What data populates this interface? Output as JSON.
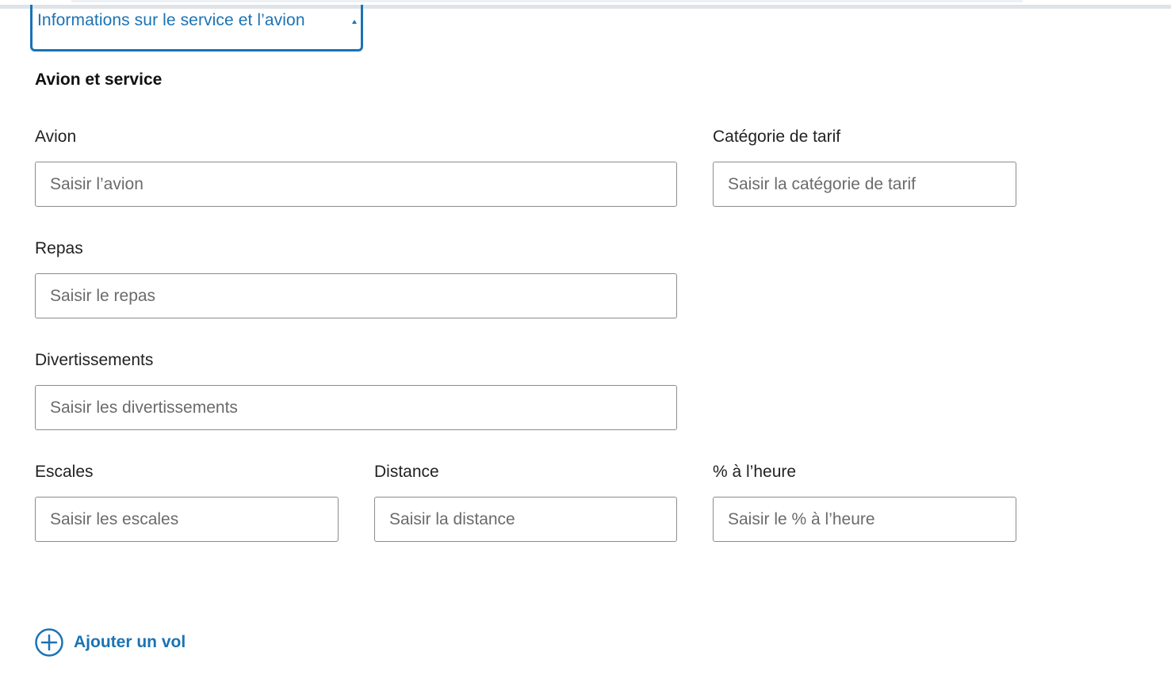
{
  "section": {
    "toggle_label": "Informations sur le service et l’avion",
    "heading": "Avion et service"
  },
  "fields": {
    "avion": {
      "label": "Avion",
      "placeholder": "Saisir l’avion"
    },
    "categorie_tarif": {
      "label": "Catégorie de tarif",
      "placeholder": "Saisir la catégorie de tarif"
    },
    "repas": {
      "label": "Repas",
      "placeholder": "Saisir le repas"
    },
    "divertissements": {
      "label": "Divertissements",
      "placeholder": "Saisir les divertissements"
    },
    "escales": {
      "label": "Escales",
      "placeholder": "Saisir les escales"
    },
    "distance": {
      "label": "Distance",
      "placeholder": "Saisir la distance"
    },
    "ponctualite": {
      "label": "% à l’heure",
      "placeholder": "Saisir le % à l’heure"
    }
  },
  "actions": {
    "add_flight_label": "Ajouter un vol"
  },
  "icons": {
    "toggle_caret": "caret-up-icon",
    "add_flight": "plus-circle-icon"
  },
  "colors": {
    "accent": "#1a73b5",
    "input_border": "#8c8c8c",
    "placeholder": "#6b6b6b"
  }
}
